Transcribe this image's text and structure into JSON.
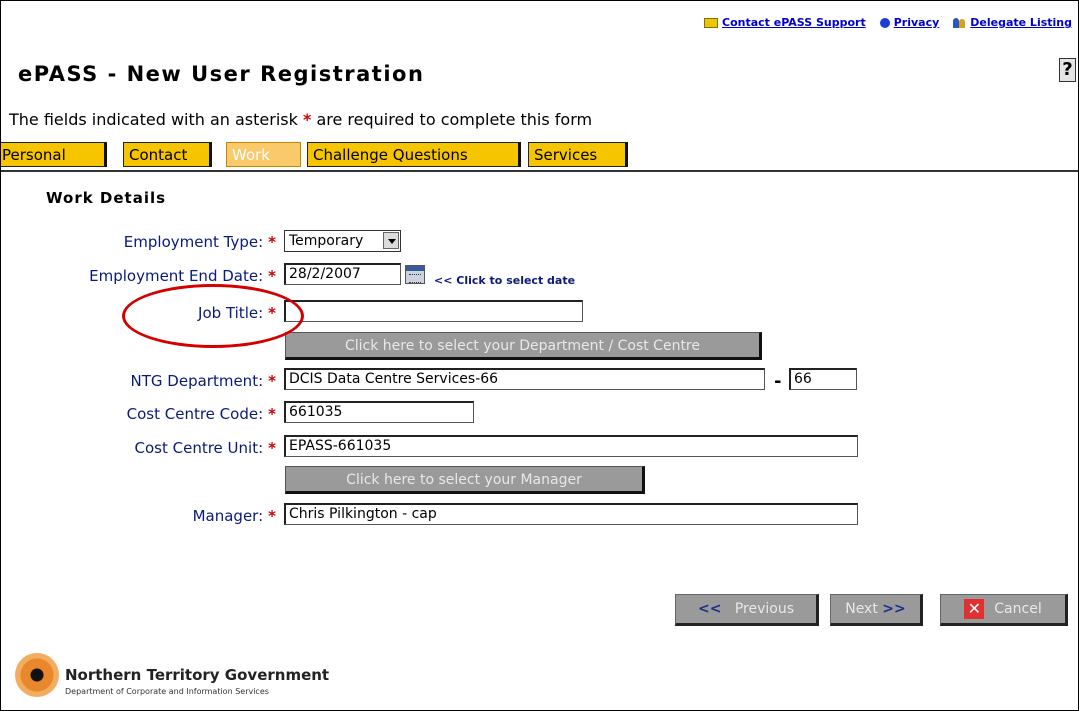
{
  "top_links": [
    {
      "icon": "mail-icon",
      "label": "Contact ePASS Support"
    },
    {
      "icon": "privacy-icon",
      "label": "Privacy"
    },
    {
      "icon": "delegate-icon",
      "label": "Delegate Listing"
    }
  ],
  "page_title": "ePASS - New User Registration",
  "help_label": "?",
  "instructions": {
    "before": "The fields indicated with an asterisk",
    "asterisk": "*",
    "after": "are required to complete this form"
  },
  "tabs": [
    {
      "label": "Personal",
      "active": false
    },
    {
      "label": "Contact",
      "active": false
    },
    {
      "label": "Work",
      "active": true
    },
    {
      "label": "Challenge Questions",
      "active": false
    },
    {
      "label": "Services",
      "active": false
    }
  ],
  "section_title": "Work Details",
  "form": {
    "employment_type": {
      "label": "Employment Type:",
      "value": "Temporary"
    },
    "employment_end_date": {
      "label": "Employment End Date:",
      "value": "28/2/2007",
      "hint": "<< Click to select date"
    },
    "job_title": {
      "label": "Job Title:",
      "value": ""
    },
    "select_department_button": "Click here to select your Department / Cost Centre",
    "ntg_department": {
      "label": "NTG Department:",
      "value": "DCIS Data Centre Services-66",
      "separator": "-",
      "code": "66"
    },
    "cost_centre_code": {
      "label": "Cost Centre Code:",
      "value": "661035"
    },
    "cost_centre_unit": {
      "label": "Cost Centre Unit:",
      "value": "EPASS-661035"
    },
    "select_manager_button": "Click here to select your Manager",
    "manager": {
      "label": "Manager:",
      "value": "Chris Pilkington - cap"
    },
    "required_marker": "*"
  },
  "nav": {
    "previous": {
      "arrow": "<<",
      "label": "Previous"
    },
    "next": {
      "arrow": ">>",
      "label": "Next"
    },
    "cancel": {
      "label": "Cancel"
    }
  },
  "footer": {
    "org_name": "Northern Territory Government",
    "dept_name": "Department of Corporate and Information Services"
  },
  "colors": {
    "tab_bg": "#f7c500",
    "required": "#d10000",
    "label": "#0a1a7a",
    "highlight_circle": "#d40000"
  }
}
